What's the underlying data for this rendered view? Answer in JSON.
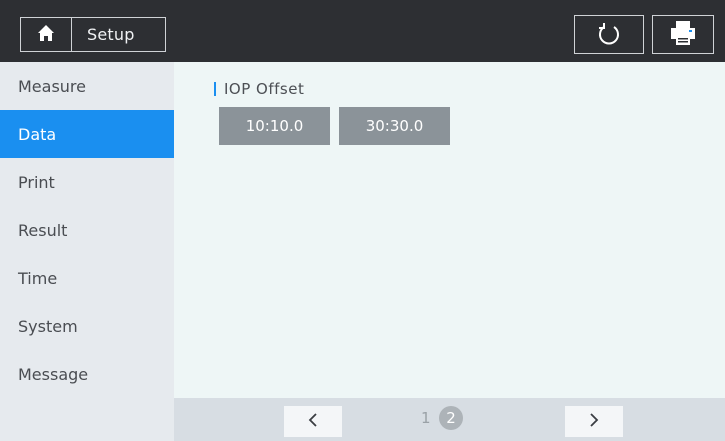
{
  "header": {
    "title": "Setup",
    "home_icon": "home-icon",
    "refresh_icon": "refresh-icon",
    "print_icon": "printer-icon"
  },
  "sidebar": {
    "items": [
      {
        "label": "Measure",
        "active": false
      },
      {
        "label": "Data",
        "active": true
      },
      {
        "label": "Print",
        "active": false
      },
      {
        "label": "Result",
        "active": false
      },
      {
        "label": "Time",
        "active": false
      },
      {
        "label": "System",
        "active": false
      },
      {
        "label": "Message",
        "active": false
      }
    ]
  },
  "content": {
    "section_label": "IOP Offset",
    "buttons": [
      "10:10.0",
      "30:30.0"
    ]
  },
  "pager": {
    "pages": [
      "1",
      "2"
    ],
    "current_page": "2"
  },
  "colors": {
    "accent": "#1a8ff0",
    "header_bg": "#2d2f33",
    "sidebar_bg": "#e6eaee",
    "content_bg": "#eef6f6",
    "offset_button_bg": "#8b9399"
  }
}
